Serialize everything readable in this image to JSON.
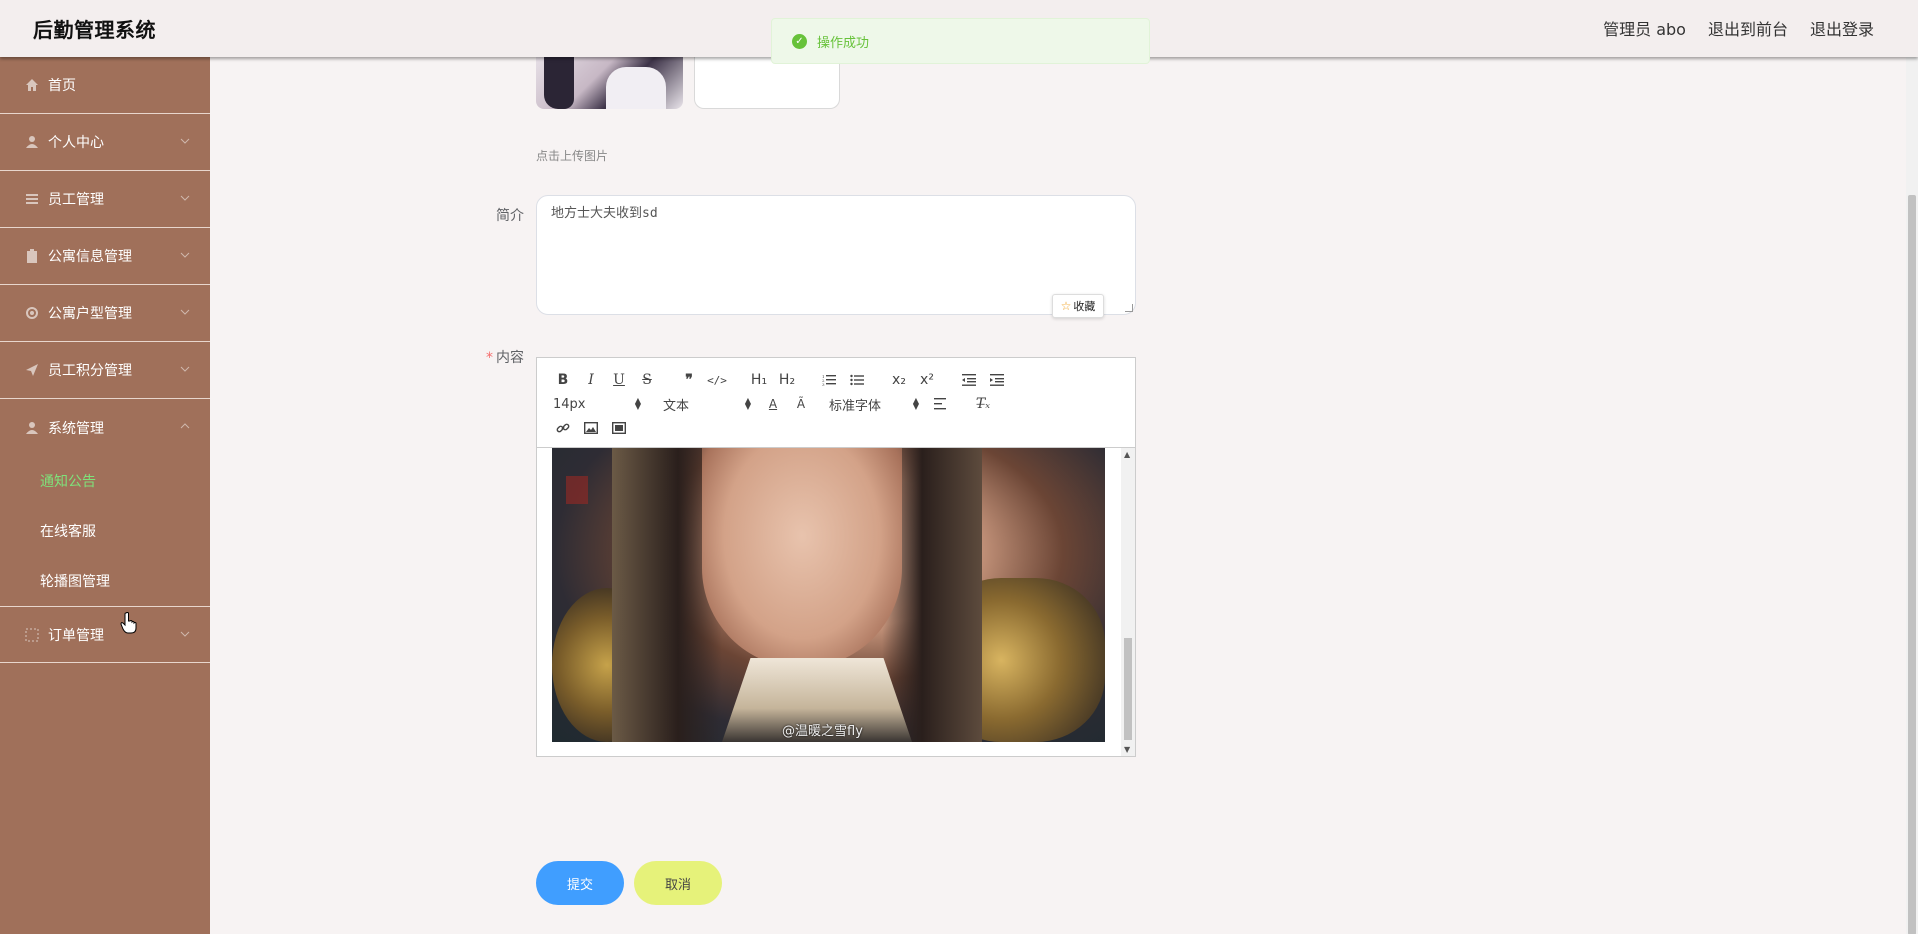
{
  "header": {
    "title": "后勤管理系统",
    "user_label": "管理员 abo",
    "to_front": "退出到前台",
    "logout": "退出登录"
  },
  "toast": {
    "message": "操作成功",
    "type": "success",
    "color": "#67c23a"
  },
  "sidebar": {
    "items": [
      {
        "label": "首页",
        "icon": "home-icon",
        "has_children": false
      },
      {
        "label": "个人中心",
        "icon": "user-icon",
        "has_children": true
      },
      {
        "label": "员工管理",
        "icon": "list-icon",
        "has_children": true
      },
      {
        "label": "公寓信息管理",
        "icon": "clipboard-icon",
        "has_children": true
      },
      {
        "label": "公寓户型管理",
        "icon": "settings-icon",
        "has_children": true
      },
      {
        "label": "员工积分管理",
        "icon": "send-icon",
        "has_children": true
      },
      {
        "label": "系统管理",
        "icon": "user-icon",
        "has_children": true,
        "expanded": true
      },
      {
        "label": "订单管理",
        "icon": "dashed-box-icon",
        "has_children": true
      }
    ],
    "submenu": [
      {
        "label": "通知公告",
        "active": true
      },
      {
        "label": "在线客服",
        "active": false
      },
      {
        "label": "轮播图管理",
        "active": false
      }
    ],
    "background": "#a0705a",
    "active_color": "#7fe27a"
  },
  "form": {
    "upload_tip": "点击上传图片",
    "intro_label": "简介",
    "intro_value": "地方士大夫收到sd",
    "collect_label": "收藏",
    "content_label": "内容",
    "content_required": "*"
  },
  "editor": {
    "font_size": "14px",
    "header_select": "文本",
    "font_family": "标准字体",
    "image_watermark": "@温暖之雪fly"
  },
  "buttons": {
    "submit": "提交",
    "cancel": "取消"
  },
  "colors": {
    "primary": "#409eff",
    "cancel": "#e6f27a"
  }
}
